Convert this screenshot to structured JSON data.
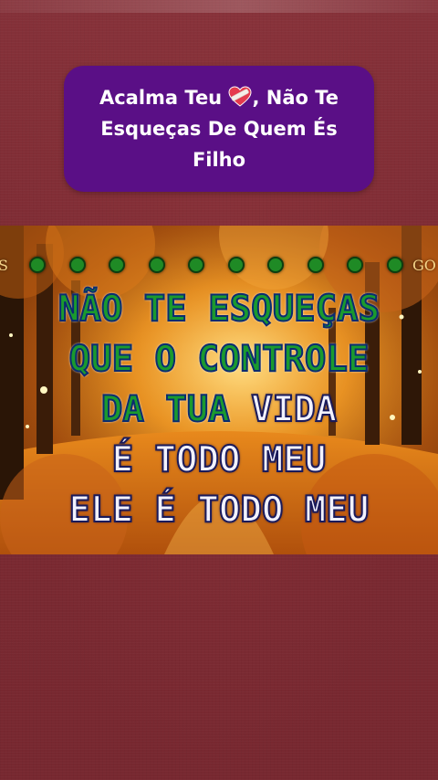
{
  "caption": {
    "text_before_icon": "Acalma Teu ",
    "icon": "bandaged-heart-icon",
    "text_after_icon": ", Não Te Esqueças De Quem És Filho"
  },
  "karaoke": {
    "left_edge_text": "S",
    "right_edge_text": "GO",
    "progress_dot_count": 10,
    "lines": [
      {
        "sung": "NÃO TE ESQUEÇAS",
        "unsung": ""
      },
      {
        "sung": "QUE O CONTROLE",
        "unsung": ""
      },
      {
        "sung": "DA TUA ",
        "unsung": "VIDA"
      },
      {
        "sung": "",
        "unsung": "É TODO MEU"
      },
      {
        "sung": "",
        "unsung": "ELE É TODO MEU"
      }
    ]
  },
  "colors": {
    "background": "#7e2b33",
    "caption_box": "#5a0f86",
    "sung_text": "#1a9a2e",
    "unsung_text": "#f2f2ff",
    "dots": "#1f8a25"
  }
}
